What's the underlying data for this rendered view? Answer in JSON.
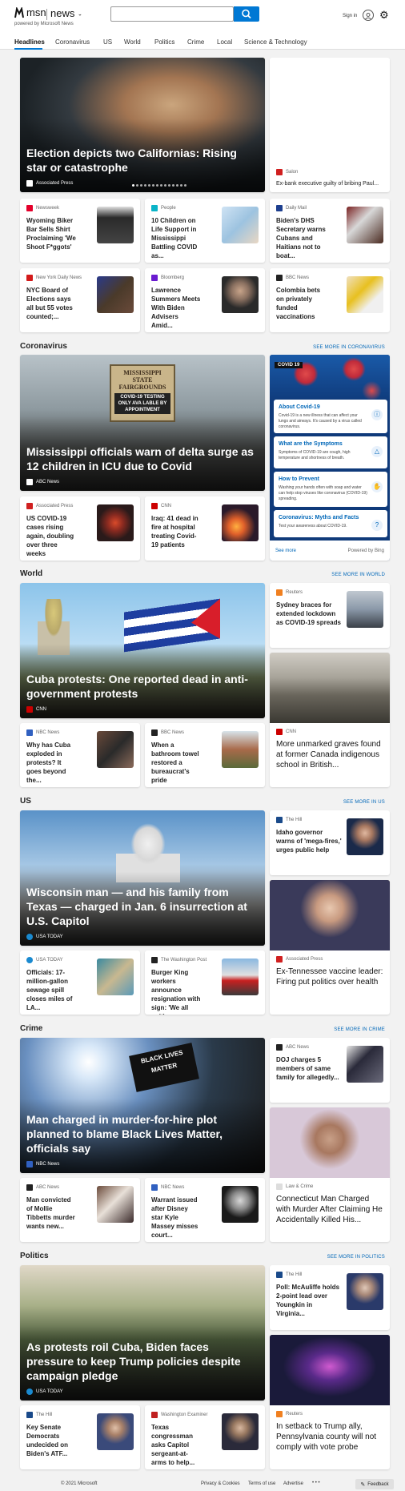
{
  "header": {
    "brand": "msn",
    "brand_section": "news",
    "powered": "powered by Microsoft News",
    "search_placeholder": "",
    "signin": "Sign in"
  },
  "nav": [
    "Headlines",
    "Coronavirus",
    "US",
    "World",
    "Politics",
    "Crime",
    "Local",
    "Science & Technology"
  ],
  "top": {
    "hero": {
      "title": "Election depicts two Californias: Rising star or catastrophe",
      "source": "Associated Press"
    },
    "side": {
      "source": "Salon",
      "title": "Ex-bank executive guilty of bribing Paul..."
    },
    "row1": [
      {
        "source": "Newsweek",
        "title": "Wyoming Biker Bar Sells Shirt Proclaiming 'We Shoot F*ggots'"
      },
      {
        "source": "People",
        "title": "10 Children on Life Support in Mississippi Battling COVID as..."
      },
      {
        "source": "Daily Mail",
        "title": "Biden's DHS Secretary warns Cubans and Haitians not to boat..."
      }
    ],
    "row2": [
      {
        "source": "New York Daily News",
        "title": "NYC Board of Elections says all but 55 votes counted;..."
      },
      {
        "source": "Bloomberg",
        "title": "Lawrence Summers Meets With Biden Advisers Amid..."
      },
      {
        "source": "BBC News",
        "title": "Colombia bets on privately funded vaccinations"
      }
    ]
  },
  "coronavirus": {
    "label": "Coronavirus",
    "more": "SEE MORE IN CORONAVIRUS",
    "hero": {
      "title": "Mississippi officials warn of delta surge as 12 children in ICU due to Covid",
      "source": "ABC News",
      "sign1": "MISSISSIPPI STATE FAIRGROUNDS",
      "sign2": "COVID-19 TESTING ONLY AVA LABLE BY APPOINTMENT"
    },
    "cards": [
      {
        "source": "Associated Press",
        "title": "US COVID-19 cases rising again, doubling over three weeks"
      },
      {
        "source": "CNN",
        "title": "Iraq: 41 dead in fire at hospital treating Covid-19 patients"
      }
    ],
    "panel": {
      "badge": "COVID 19",
      "items": [
        {
          "title": "About Covid-19",
          "desc": "Covid-19 is a new illness that can affect your lungs and airways. It's caused by a virus called coronavirus."
        },
        {
          "title": "What are the Symptoms",
          "desc": "Symptoms of COVID-19 are cough, high temperature and shortness of breath."
        },
        {
          "title": "How to Prevent",
          "desc": "Washing your hands often with soap and water can help stop viruses like coronavirus (COVID-19) spreading."
        },
        {
          "title": "Coronavirus: Myths and Facts",
          "desc": "Test your awareness about COVID-19."
        }
      ],
      "see_more": "See more",
      "powered": "Powered by Bing"
    }
  },
  "world": {
    "label": "World",
    "more": "SEE MORE IN WORLD",
    "hero": {
      "title": "Cuba protests: One reported dead in anti-government protests",
      "source": "CNN"
    },
    "side_top": {
      "source": "Reuters",
      "title": "Sydney braces for extended lockdown as COVID-19 spreads"
    },
    "side_big": {
      "source": "CNN",
      "title": "More unmarked graves found at former Canada indigenous school in British..."
    },
    "cards": [
      {
        "source": "NBC News",
        "title": "Why has Cuba exploded in protests? It goes beyond the..."
      },
      {
        "source": "BBC News",
        "title": "When a bathroom towel restored a bureaucrat's pride"
      }
    ]
  },
  "us": {
    "label": "US",
    "more": "SEE MORE IN US",
    "hero": {
      "title": "Wisconsin man — and his family from Texas — charged in Jan. 6 insurrection at U.S. Capitol",
      "source": "USA TODAY"
    },
    "side_top": {
      "source": "The Hill",
      "title": "Idaho governor warns of 'mega-fires,' urges public help"
    },
    "side_big": {
      "source": "Associated Press",
      "title": "Ex-Tennessee vaccine leader: Firing put politics over health"
    },
    "cards": [
      {
        "source": "USA TODAY",
        "title": "Officials: 17-million-gallon sewage spill closes miles of LA..."
      },
      {
        "source": "The Washington Post",
        "title": "Burger King workers announce resignation with sign: 'We all quit'"
      }
    ]
  },
  "crime": {
    "label": "Crime",
    "more": "SEE MORE IN CRIME",
    "hero": {
      "title": "Man charged in murder-for-hire plot planned to blame Black Lives Matter, officials say",
      "source": "NBC News",
      "flag": "BLACK LIVES MATTER"
    },
    "side_top": {
      "source": "ABC News",
      "title": "DOJ charges 5 members of same family for allegedly..."
    },
    "side_big": {
      "source": "Law & Crime",
      "title": "Connecticut Man Charged with Murder After Claiming He Accidentally Killed His..."
    },
    "cards": [
      {
        "source": "ABC News",
        "title": "Man convicted of Mollie Tibbetts murder wants new..."
      },
      {
        "source": "NBC News",
        "title": "Warrant issued after Disney star Kyle Massey misses court..."
      }
    ]
  },
  "politics": {
    "label": "Politics",
    "more": "SEE MORE IN POLITICS",
    "hero": {
      "title": "As protests roil Cuba, Biden faces pressure to keep Trump policies despite campaign pledge",
      "source": "USA TODAY"
    },
    "side_top": {
      "source": "The Hill",
      "title": "Poll: McAuliffe holds 2-point lead over Youngkin in Virginia..."
    },
    "side_big": {
      "source": "Reuters",
      "title": "In setback to Trump ally, Pennsylvania county will not comply with vote probe"
    },
    "cards": [
      {
        "source": "The Hill",
        "title": "Key Senate Democrats undecided on Biden's ATF..."
      },
      {
        "source": "Washington Examiner",
        "title": "Texas congressman asks Capitol sergeant-at-arms to help..."
      }
    ]
  },
  "footer": {
    "copyright": "© 2021 Microsoft",
    "links": [
      "Privacy & Cookies",
      "Terms of use",
      "Advertise"
    ],
    "more": "• • •",
    "feedback": "Feedback"
  }
}
